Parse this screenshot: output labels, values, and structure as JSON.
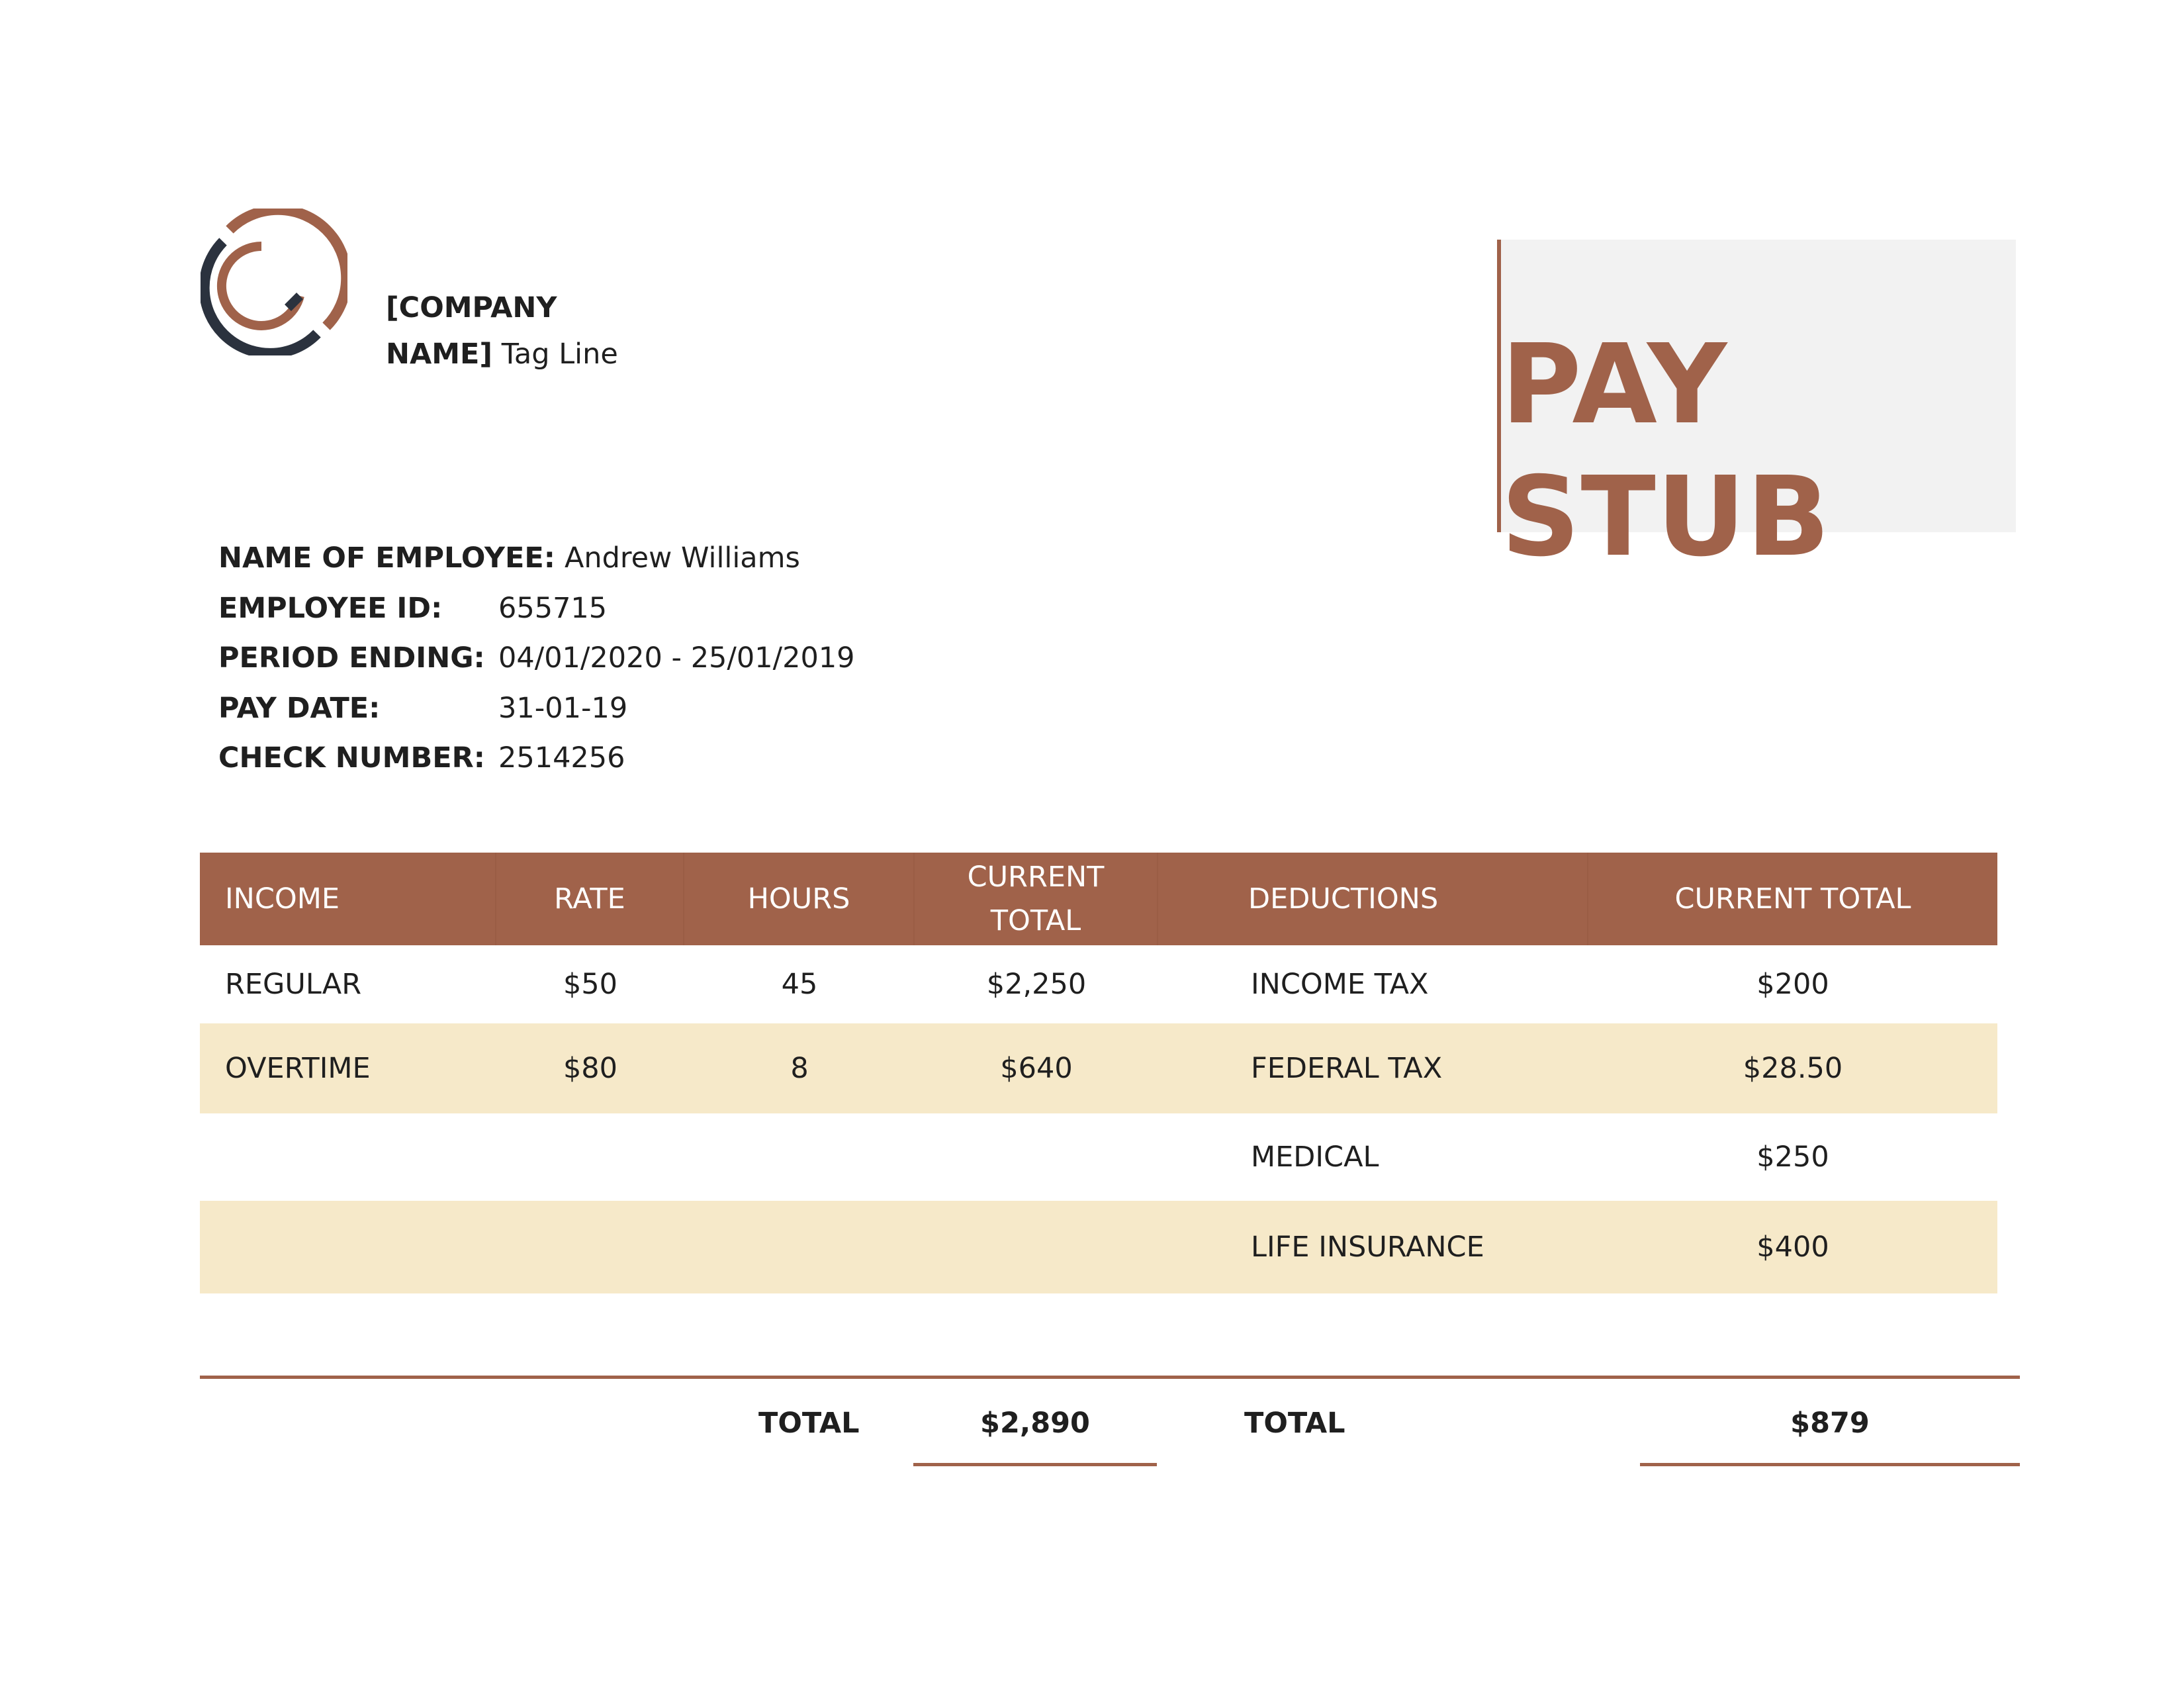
{
  "company": {
    "name_line1": "[COMPANY",
    "name_line2": "NAME]",
    "tagline": "Tag Line"
  },
  "document_title": "PAY STUB",
  "colors": {
    "accent": "#a0624a",
    "logo_dark": "#2b323e",
    "row_shade": "#f6e9c9",
    "title_bg": "#f2f2f2"
  },
  "employee": {
    "name_label": "NAME OF EMPLOYEE:",
    "name": "Andrew Williams",
    "id_label": "EMPLOYEE ID:",
    "id": "655715",
    "period_label": "PERIOD ENDING:",
    "period": "04/01/2020 - 25/01/2019",
    "pay_date_label": "PAY DATE:",
    "pay_date": "31-01-19",
    "check_label": "CHECK NUMBER:",
    "check_number": "2514256"
  },
  "table": {
    "headers": {
      "income": "INCOME",
      "rate": "RATE",
      "hours": "HOURS",
      "current_total_line1": "CURRENT",
      "current_total_line2": "TOTAL",
      "deductions": "DEDUCTIONS",
      "deductions_total": "CURRENT TOTAL"
    },
    "rows": [
      {
        "income": "REGULAR",
        "rate": "$50",
        "hours": "45",
        "total": "$2,250",
        "deduction": "INCOME TAX",
        "deduction_total": "$200"
      },
      {
        "income": "OVERTIME",
        "rate": "$80",
        "hours": "8",
        "total": "$640",
        "deduction": "FEDERAL TAX",
        "deduction_total": "$28.50"
      },
      {
        "income": "",
        "rate": "",
        "hours": "",
        "total": "",
        "deduction": "MEDICAL",
        "deduction_total": "$250"
      },
      {
        "income": "",
        "rate": "",
        "hours": "",
        "total": "",
        "deduction": "LIFE INSURANCE",
        "deduction_total": "$400"
      }
    ]
  },
  "totals": {
    "income_label": "TOTAL",
    "income_total": "$2,890",
    "deductions_label": "TOTAL",
    "deductions_total": "$879"
  }
}
